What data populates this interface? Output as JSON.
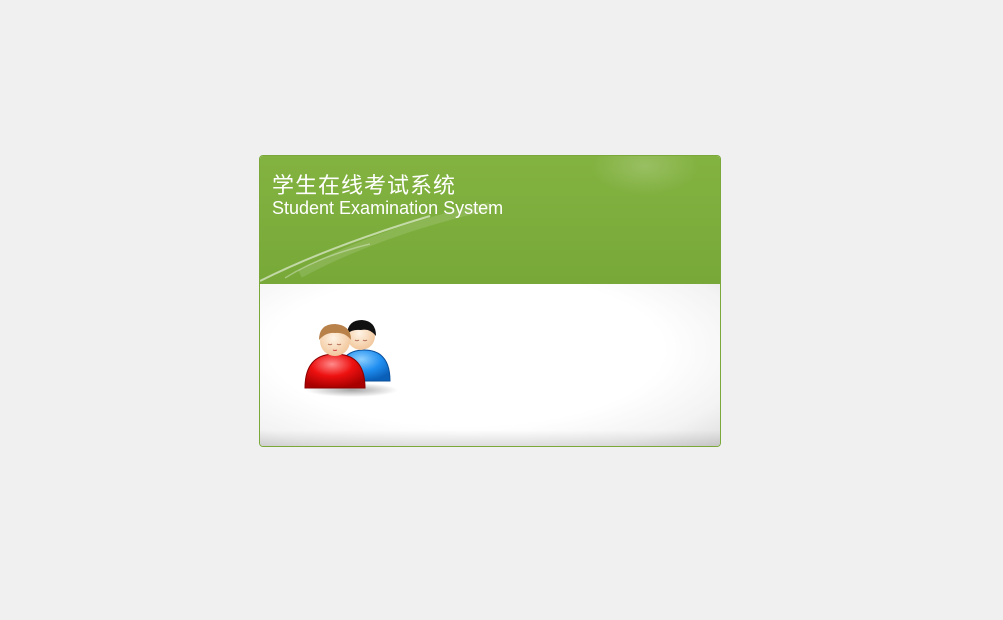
{
  "app": {
    "title_cn": "学生在线考试系统",
    "title_en": "Student Examination System"
  },
  "panel": {
    "icon": "users-icon"
  },
  "colors": {
    "background": "#f0f0f0",
    "header_green": "#7cad3c",
    "border_green": "#7aa83a",
    "body_white": "#ffffff"
  }
}
